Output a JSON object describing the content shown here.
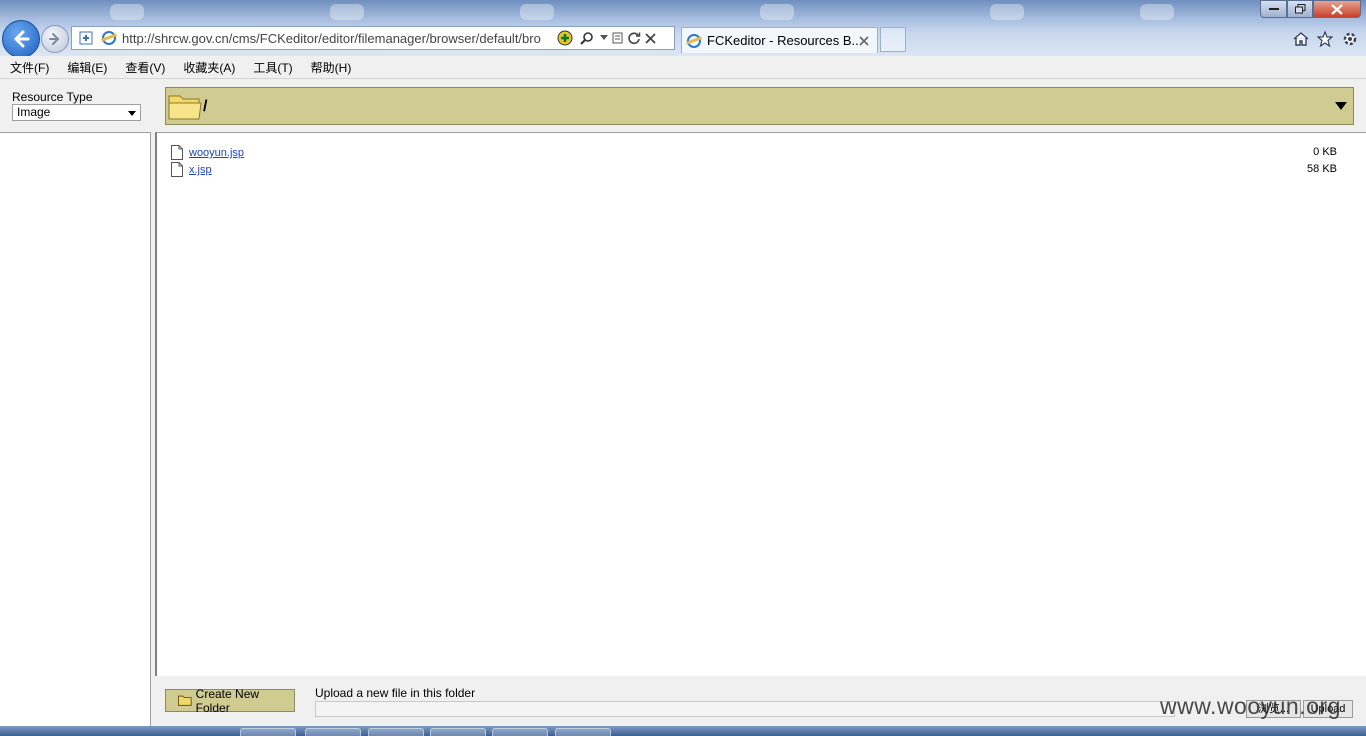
{
  "browser": {
    "address_url": "http://shrcw.gov.cn/cms/FCKeditor/editor/filemanager/browser/default/bro",
    "tab_title": "FCKeditor - Resources B...",
    "icons": [
      "back-arrow-icon",
      "forward-arrow-icon",
      "home-icon",
      "star-icon",
      "gear-icon",
      "search-icon",
      "refresh-icon",
      "close-icon"
    ]
  },
  "menubar": {
    "items": [
      "文件(F)",
      "编辑(E)",
      "查看(V)",
      "收藏夹(A)",
      "工具(T)",
      "帮助(H)"
    ]
  },
  "sidebar": {
    "resource_type_label": "Resource Type",
    "resource_type_value": "Image"
  },
  "folder": {
    "path": "/"
  },
  "files": [
    {
      "name": "wooyun.jsp",
      "size": "0 KB"
    },
    {
      "name": "x.jsp",
      "size": "58 KB"
    }
  ],
  "bottom": {
    "create_folder_label": "Create New Folder",
    "upload_label": "Upload a new file in this folder",
    "browse_label": "浏览...",
    "upload_button_label": "Upload"
  },
  "watermark": "www.wooyun.org"
}
